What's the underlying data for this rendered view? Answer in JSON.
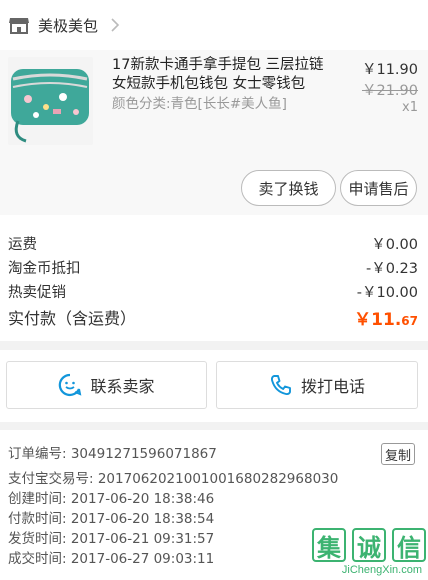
{
  "shop": {
    "name": "美极美包"
  },
  "product": {
    "title": "17新款卡通手拿手提包 三层拉链女短款手机包钱包 女士零钱包",
    "variant": "颜色分类:青色[长长#美人鱼]",
    "price": "￥11.90",
    "original_price": "￥21.90",
    "quantity": "x1",
    "buttons": {
      "refund": "卖了换钱",
      "after_sale": "申请售后"
    }
  },
  "fees": {
    "shipping_label": "运费",
    "shipping_value": "￥0.00",
    "coin_label": "淘金币抵扣",
    "coin_value": "-￥0.23",
    "promo_label": "热卖促销",
    "promo_value": "-￥10.00",
    "total_label": "实付款（含运费）",
    "total_currency": "￥",
    "total_int": "11.",
    "total_dec": "67"
  },
  "actions": {
    "contact_seller": "联系卖家",
    "call_phone": "拨打电话"
  },
  "order_info": {
    "order_no": "订单编号: 30491271596071867",
    "copy_label": "复制",
    "alipay_no": "支付宝交易号: 2017062021001001680282968030",
    "created": "创建时间: 2017-06-20 18:38:46",
    "paid": "付款时间: 2017-06-20 18:38:54",
    "shipped": "发货时间: 2017-06-21 09:31:57",
    "completed": "成交时间: 2017-06-27 09:03:11"
  },
  "watermark": {
    "chars": [
      "集",
      "诚",
      "信"
    ],
    "domain": "JiChengXin.com"
  },
  "colors": {
    "accent": "#ff5000",
    "blue_icon": "#1296db",
    "watermark": "#3cb371"
  }
}
